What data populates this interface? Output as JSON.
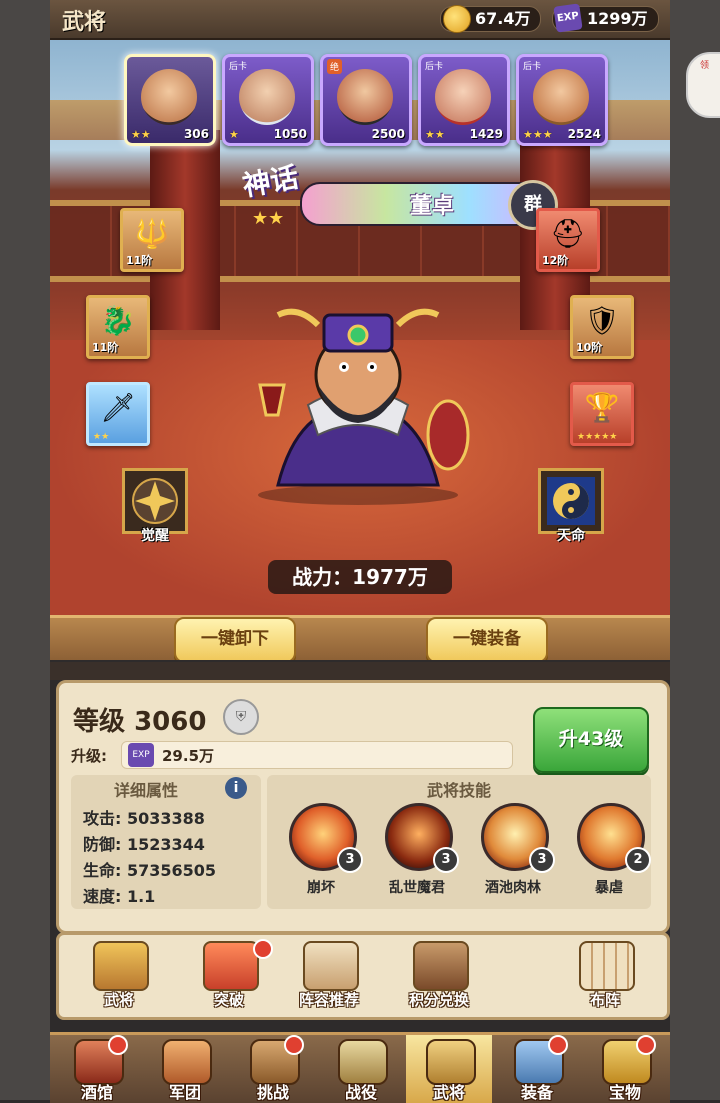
{
  "header": {
    "title": "武将",
    "coins": "67.4万",
    "exp_icon": "EXP",
    "exp": "1299万"
  },
  "side_button": {
    "label": "领"
  },
  "heroes": [
    {
      "stars": "★★",
      "count": "306",
      "tag": "",
      "selected": true
    },
    {
      "stars": "★",
      "count": "1050",
      "tag": "后卡"
    },
    {
      "stars": "",
      "count": "2500",
      "tag": "绝"
    },
    {
      "stars": "★★",
      "count": "1429",
      "tag": "后卡"
    },
    {
      "stars": "★★★",
      "count": "2524",
      "tag": "后卡"
    }
  ],
  "hero": {
    "rank_label": "神话",
    "name": "董卓",
    "faction": "群"
  },
  "equipment_left": [
    {
      "level": "11阶",
      "glyph": "🔱"
    },
    {
      "level": "11阶",
      "glyph": "🐉"
    },
    {
      "level": "",
      "glyph": "🗡",
      "stars": "★★"
    }
  ],
  "equipment_right": [
    {
      "level": "12阶",
      "glyph": "⛑"
    },
    {
      "level": "10阶",
      "glyph": "🛡"
    },
    {
      "level": "",
      "glyph": "🏆",
      "stars": "★★★★★"
    }
  ],
  "ornaments": {
    "left": "觉醒",
    "right": "天命"
  },
  "power": {
    "label": "战力：",
    "value": "1977万"
  },
  "buttons": {
    "unequip_all": "一键卸下",
    "equip_all": "一键装备",
    "level_up": "升43级"
  },
  "level": {
    "label": "等级",
    "value": "3060"
  },
  "upgrade": {
    "label": "升级:",
    "cost": "29.5万",
    "exp_icon": "EXP"
  },
  "attributes": {
    "header": "详细属性",
    "rows": [
      "攻击: 5033388",
      "防御: 1523344",
      "生命: 57356505",
      "速度: 1.1"
    ]
  },
  "skills": {
    "header": "武将技能",
    "items": [
      {
        "name": "崩坏",
        "level": "3"
      },
      {
        "name": "乱世魔君",
        "level": "3"
      },
      {
        "name": "酒池肉林",
        "level": "3"
      },
      {
        "name": "暴虐",
        "level": "2"
      }
    ]
  },
  "shortcuts": [
    "武将",
    "突破",
    "阵容推荐",
    "积分兑换",
    "布阵"
  ],
  "nav": [
    "酒馆",
    "军团",
    "挑战",
    "战役",
    "武将",
    "装备",
    "宝物"
  ],
  "colors": {
    "accent_gold": "#f0c85a",
    "level_up_green": "#3aa63a",
    "badge_red": "#e04030"
  }
}
